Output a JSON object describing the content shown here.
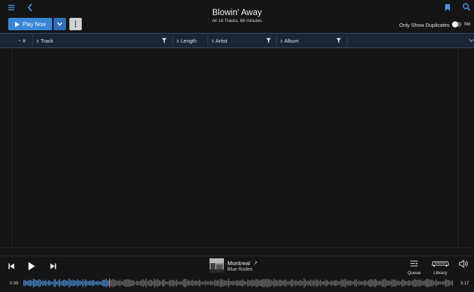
{
  "header": {
    "title": "Blowin' Away",
    "subtitle": "All 16 Tracks, 69 minutes",
    "play_label": "Play Now",
    "only_duplicates_label": "Only Show Duplicates",
    "toggle_state": "No"
  },
  "table": {
    "columns": [
      {
        "id": "number",
        "label": "#"
      },
      {
        "id": "track",
        "label": "Track"
      },
      {
        "id": "length",
        "label": "Length"
      },
      {
        "id": "artist",
        "label": "Artist"
      },
      {
        "id": "album",
        "label": "Album"
      }
    ],
    "sorted_column": "number",
    "rows": []
  },
  "now_playing": {
    "title": "Montreal",
    "artist": "Blue Rodeo",
    "elapsed": "0:39",
    "total": "3:17",
    "progress_fraction": 0.2
  },
  "controls": {
    "queue_label": "Queue",
    "library_label": "Library"
  },
  "colors": {
    "accent": "#3a86d6",
    "background": "#151516",
    "header_bg": "#1b2533",
    "waveform_played": "#4a8fd9",
    "waveform_unplayed": "#6e6e70",
    "playhead": "#d94a4a"
  },
  "icons": [
    "menu-icon",
    "back-icon",
    "bookmark-icon",
    "search-icon",
    "play-icon",
    "chevron-down-icon",
    "more-vertical-icon",
    "filter-icon",
    "sort-icon",
    "skip-previous-icon",
    "skip-next-icon",
    "pin-icon",
    "queue-icon",
    "library-icon",
    "volume-icon"
  ]
}
